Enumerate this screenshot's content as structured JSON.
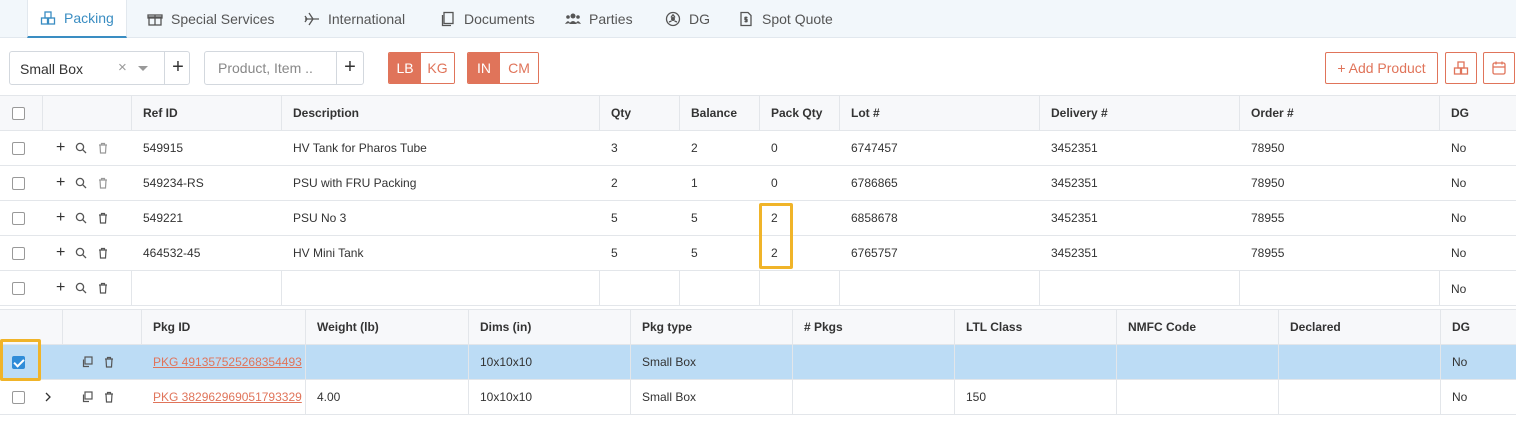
{
  "tabs": [
    {
      "label": "Packing",
      "icon": "boxes-icon"
    },
    {
      "label": "Special Services",
      "icon": "gift-icon"
    },
    {
      "label": "International",
      "icon": "plane-icon"
    },
    {
      "label": "Documents",
      "icon": "copy-icon"
    },
    {
      "label": "Parties",
      "icon": "users-icon"
    },
    {
      "label": "DG",
      "icon": "radiation-icon"
    },
    {
      "label": "Spot Quote",
      "icon": "dollar-file-icon"
    }
  ],
  "toolbar": {
    "package_select_value": "Small Box",
    "clear_symbol": "×",
    "product_placeholder": "Product, Item ..",
    "weight_units": [
      "LB",
      "KG"
    ],
    "dim_units": [
      "IN",
      "CM"
    ],
    "add_product_label": "+ Add Product",
    "plus_symbol": "+"
  },
  "products": {
    "columns": [
      "Ref ID",
      "Description",
      "Qty",
      "Balance",
      "Pack Qty",
      "Lot #",
      "Delivery #",
      "Order #",
      "DG"
    ],
    "rows": [
      {
        "ref": "549915",
        "desc": "HV Tank for Pharos Tube",
        "qty": "3",
        "balance": "2",
        "pack": "0",
        "lot": "6747457",
        "delivery": "3452351",
        "order": "78950",
        "dg": "No"
      },
      {
        "ref": "549234-RS",
        "desc": "PSU with FRU Packing",
        "qty": "2",
        "balance": "1",
        "pack": "0",
        "lot": "6786865",
        "delivery": "3452351",
        "order": "78950",
        "dg": "No"
      },
      {
        "ref": "549221",
        "desc": "PSU No 3",
        "qty": "5",
        "balance": "5",
        "pack": "2",
        "lot": "6858678",
        "delivery": "3452351",
        "order": "78955",
        "dg": "No"
      },
      {
        "ref": "464532-45",
        "desc": "HV Mini Tank",
        "qty": "5",
        "balance": "5",
        "pack": "2",
        "lot": "6765757",
        "delivery": "3452351",
        "order": "78955",
        "dg": "No"
      },
      {
        "ref": "",
        "desc": "",
        "qty": "",
        "balance": "",
        "pack": "",
        "lot": "",
        "delivery": "",
        "order": "",
        "dg": "No"
      }
    ]
  },
  "packages": {
    "columns": [
      "Pkg ID",
      "Weight (lb)",
      "Dims (in)",
      "Pkg type",
      "# Pkgs",
      "LTL Class",
      "NMFC Code",
      "Declared",
      "DG"
    ],
    "rows": [
      {
        "pkg_id": "PKG 491357525268354493",
        "weight": "",
        "dims": "10x10x10",
        "type": "Small Box",
        "pkgs": "",
        "ltl": "",
        "nmfc": "",
        "declared": "",
        "dg": "No"
      },
      {
        "pkg_id": "PKG 382962969051793329",
        "weight": "4.00",
        "dims": "10x10x10",
        "type": "Small Box",
        "pkgs": "",
        "ltl": "150",
        "nmfc": "",
        "declared": "",
        "dg": "No"
      }
    ]
  },
  "colors": {
    "accent": "#e0745a",
    "tab_active": "#3a8dc2",
    "selected_row": "#bcdcf5",
    "highlight": "#f0b429"
  }
}
